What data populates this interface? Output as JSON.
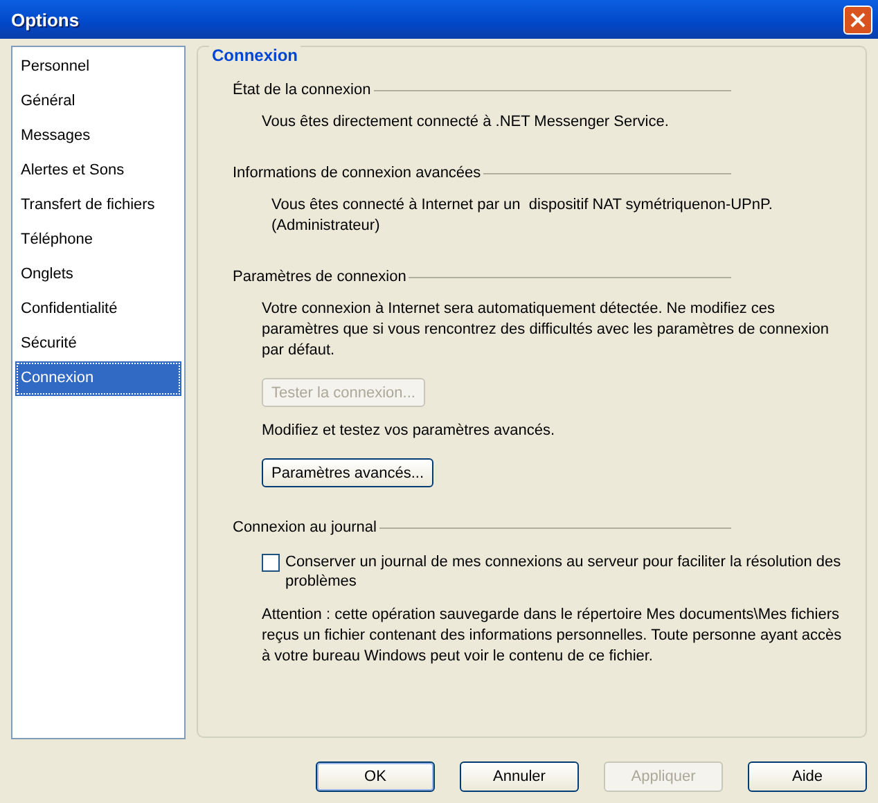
{
  "window": {
    "title": "Options"
  },
  "sidebar": {
    "items": [
      {
        "label": "Personnel",
        "selected": false
      },
      {
        "label": "Général",
        "selected": false
      },
      {
        "label": "Messages",
        "selected": false
      },
      {
        "label": "Alertes et Sons",
        "selected": false
      },
      {
        "label": "Transfert de fichiers",
        "selected": false
      },
      {
        "label": "Téléphone",
        "selected": false
      },
      {
        "label": "Onglets",
        "selected": false
      },
      {
        "label": "Confidentialité",
        "selected": false
      },
      {
        "label": "Sécurité",
        "selected": false
      },
      {
        "label": "Connexion",
        "selected": true
      }
    ]
  },
  "panel": {
    "title": "Connexion",
    "sections": [
      {
        "heading": "État de la connexion",
        "items": [
          {
            "kind": "text",
            "text": "Vous êtes directement connecté à .NET Messenger Service."
          }
        ]
      },
      {
        "heading": "Informations de connexion avancées",
        "items": [
          {
            "kind": "info",
            "text": "Vous êtes connecté à Internet par un  dispositif NAT symétriquenon-UPnP.\n(Administrateur)"
          }
        ]
      },
      {
        "heading": "Paramètres de connexion",
        "items": [
          {
            "kind": "text",
            "text": "Votre connexion à Internet sera automatiquement détectée. Ne modifiez ces paramètres que si vous rencontrez des difficultés avec les paramètres de connexion par défaut."
          },
          {
            "kind": "button",
            "label": "Tester la connexion...",
            "disabled": true
          },
          {
            "kind": "text",
            "text": "Modifiez et testez vos paramètres avancés."
          },
          {
            "kind": "button",
            "label": "Paramètres avancés...",
            "disabled": false
          }
        ]
      },
      {
        "heading": "Connexion au journal",
        "items": [
          {
            "kind": "checkbox",
            "label": "Conserver un journal de mes connexions au serveur pour faciliter la résolution des problèmes",
            "checked": false
          },
          {
            "kind": "text",
            "text": "Attention : cette opération sauvegarde dans le répertoire Mes documents\\Mes fichiers reçus un fichier contenant des informations personnelles. Toute personne ayant accès à votre bureau Windows peut voir le contenu de ce fichier."
          }
        ]
      }
    ]
  },
  "buttons": [
    {
      "label": "OK",
      "disabled": false,
      "default": true
    },
    {
      "label": "Annuler",
      "disabled": false,
      "default": false
    },
    {
      "label": "Appliquer",
      "disabled": true,
      "default": false
    },
    {
      "label": "Aide",
      "disabled": false,
      "default": false
    }
  ]
}
